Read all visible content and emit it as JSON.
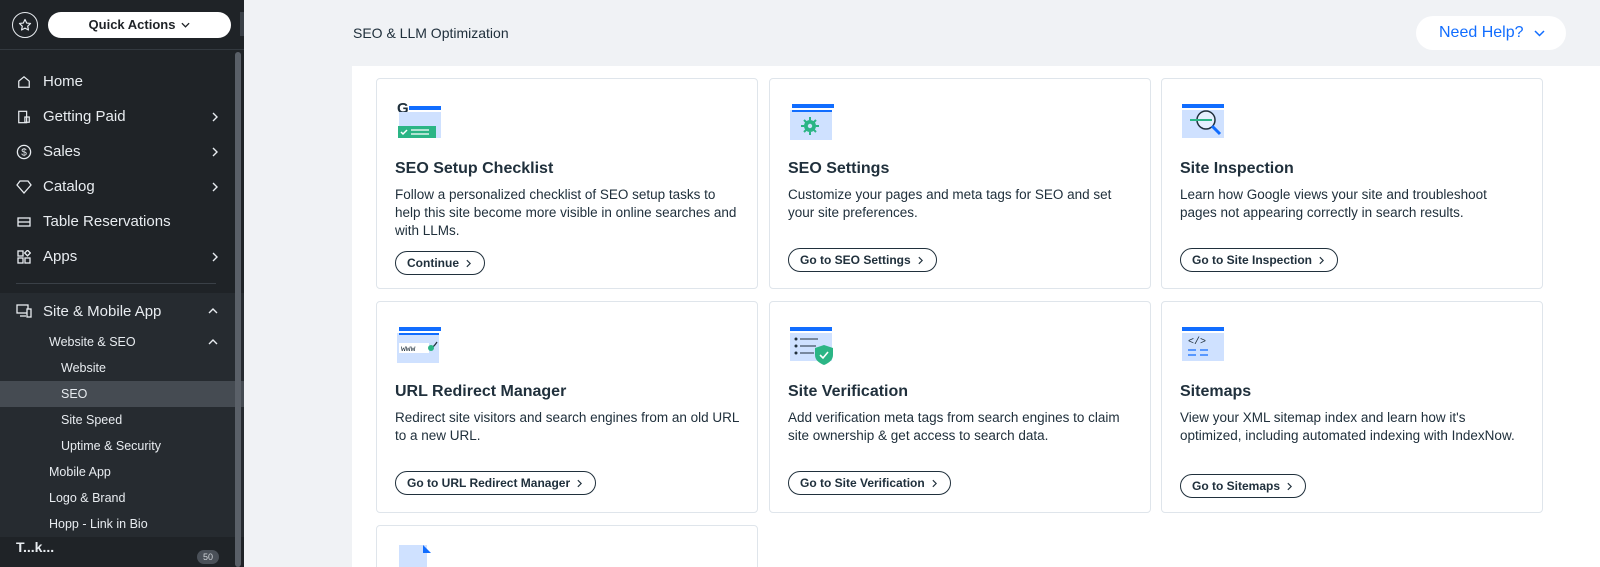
{
  "sidebar": {
    "quick_actions": "Quick Actions",
    "items": [
      {
        "label": "Home",
        "icon": "home-icon"
      },
      {
        "label": "Getting Paid",
        "icon": "invoice-icon"
      },
      {
        "label": "Sales",
        "icon": "dollar-icon"
      },
      {
        "label": "Catalog",
        "icon": "catalog-icon"
      },
      {
        "label": "Table Reservations",
        "icon": "table-icon"
      },
      {
        "label": "Apps",
        "icon": "apps-icon"
      }
    ],
    "site_group": {
      "label": "Site & Mobile App",
      "website_seo": "Website & SEO",
      "website": "Website",
      "seo": "SEO",
      "site_speed": "Site Speed",
      "uptime": "Uptime & Security",
      "mobile_app": "Mobile App",
      "logo": "Logo & Brand",
      "hopp": "Hopp - Link in Bio"
    },
    "partial_item": "T...k...",
    "badge": "50"
  },
  "header": {
    "title": "SEO & LLM Optimization",
    "help": "Need Help?"
  },
  "cards": [
    {
      "title": "SEO Setup Checklist",
      "desc": "Follow a personalized checklist of SEO setup tasks to help this site become more visible in online searches and with LLMs.",
      "cta": "Continue"
    },
    {
      "title": "SEO Settings",
      "desc": "Customize your pages and meta tags for SEO and set your site preferences.",
      "cta": "Go to SEO Settings"
    },
    {
      "title": "Site Inspection",
      "desc": "Learn how Google views your site and troubleshoot pages not appearing correctly in search results.",
      "cta": "Go to Site Inspection"
    },
    {
      "title": "URL Redirect Manager",
      "desc": "Redirect site visitors and search engines from an old URL to a new URL.",
      "cta": "Go to URL Redirect Manager"
    },
    {
      "title": "Site Verification",
      "desc": "Add verification meta tags from search engines to claim site ownership & get access to search data.",
      "cta": "Go to Site Verification"
    },
    {
      "title": "Sitemaps",
      "desc": "View your XML sitemap index and learn how it's optimized, including automated indexing with IndexNow.",
      "cta": "Go to Sitemaps"
    }
  ],
  "colors": {
    "accent": "#116dff",
    "sidebar_bg": "#1f2327",
    "card_border": "#dfe5eb"
  }
}
